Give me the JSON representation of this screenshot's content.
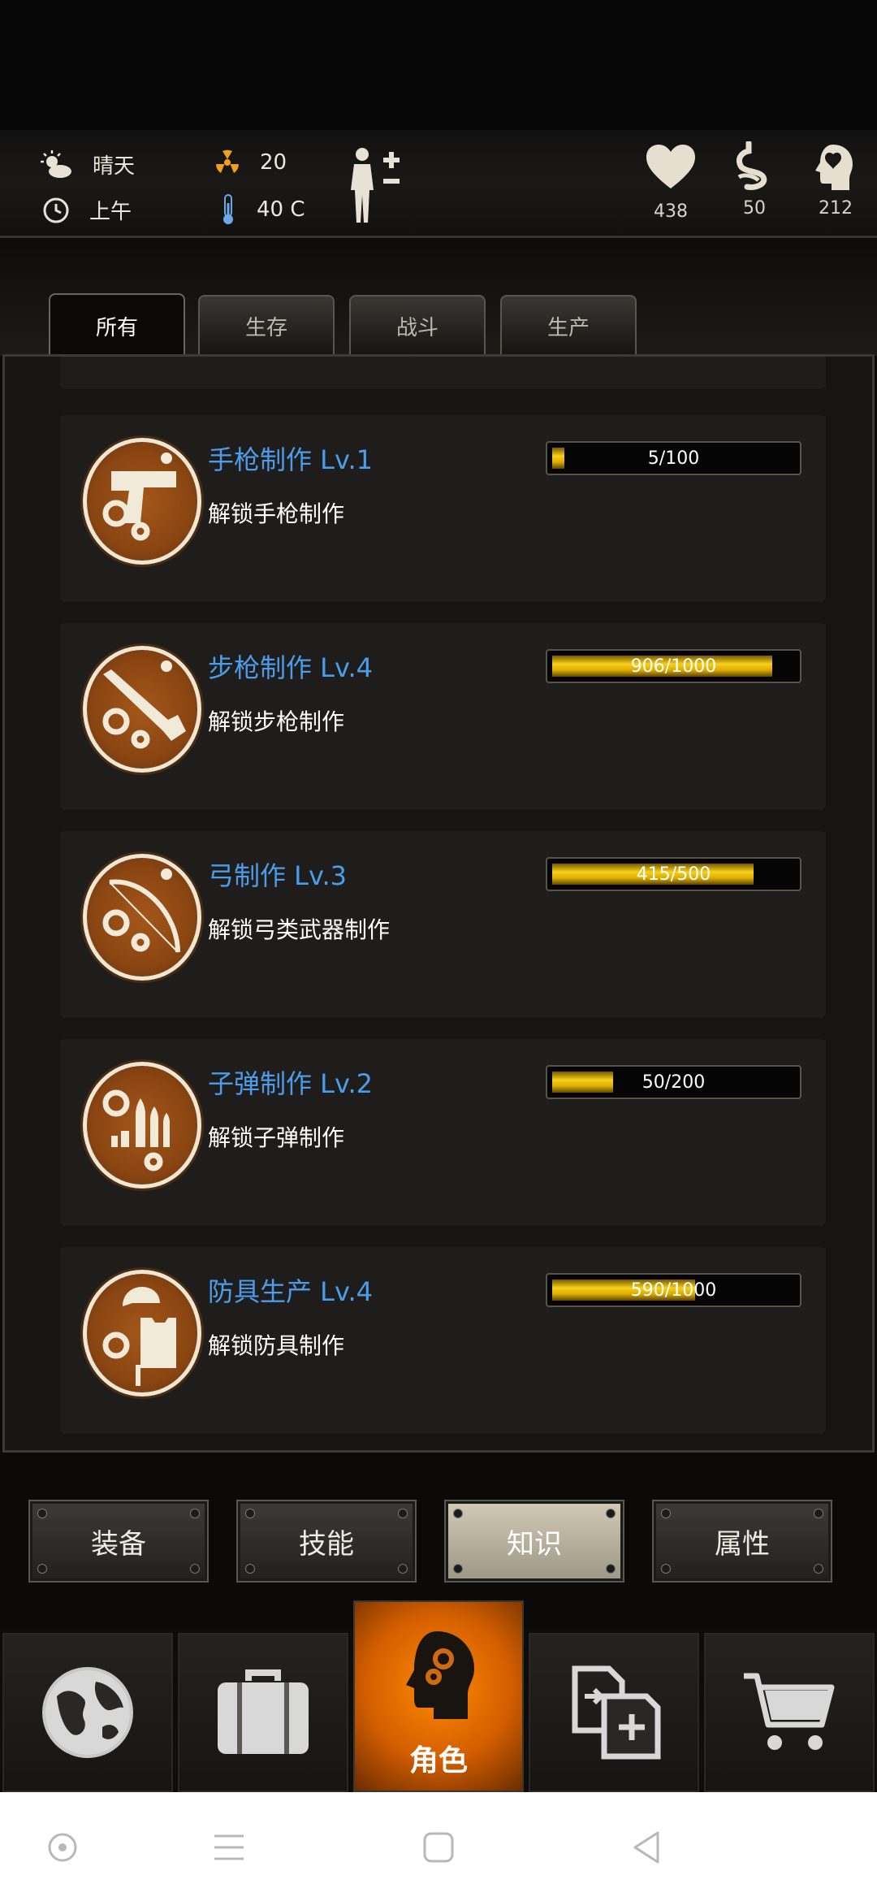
{
  "hud": {
    "weather": "晴天",
    "time_of_day": "上午",
    "radiation": "20",
    "temperature": "40 C",
    "health": "438",
    "hunger": "50",
    "mental": "212"
  },
  "tabs": [
    {
      "label": "所有",
      "active": true
    },
    {
      "label": "生存",
      "active": false
    },
    {
      "label": "战斗",
      "active": false
    },
    {
      "label": "生产",
      "active": false
    }
  ],
  "skills": [
    {
      "title": "手枪制作 Lv.1",
      "desc": "解锁手枪制作",
      "progress": "5/100",
      "fraction": 0.05,
      "icon": "pistol-gear-icon"
    },
    {
      "title": "步枪制作 Lv.4",
      "desc": "解锁步枪制作",
      "progress": "906/1000",
      "fraction": 0.906,
      "icon": "rifle-gear-icon"
    },
    {
      "title": "弓制作 Lv.3",
      "desc": "解锁弓类武器制作",
      "progress": "415/500",
      "fraction": 0.83,
      "icon": "bow-gear-icon"
    },
    {
      "title": "子弹制作 Lv.2",
      "desc": "解锁子弹制作",
      "progress": "50/200",
      "fraction": 0.25,
      "icon": "bullets-gear-icon"
    },
    {
      "title": "防具生产 Lv.4",
      "desc": "解锁防具制作",
      "progress": "590/1000",
      "fraction": 0.59,
      "icon": "armor-gear-icon"
    }
  ],
  "subnav": [
    {
      "label": "装备",
      "active": false
    },
    {
      "label": "技能",
      "active": false
    },
    {
      "label": "知识",
      "active": true
    },
    {
      "label": "属性",
      "active": false
    }
  ],
  "bottom_nav": {
    "active_label": "角色"
  },
  "colors": {
    "title_blue": "#4b9dea",
    "bar_gold": "#f7d11a",
    "active_orange": "#ff8a00",
    "emblem_brown": "#8a4512"
  }
}
